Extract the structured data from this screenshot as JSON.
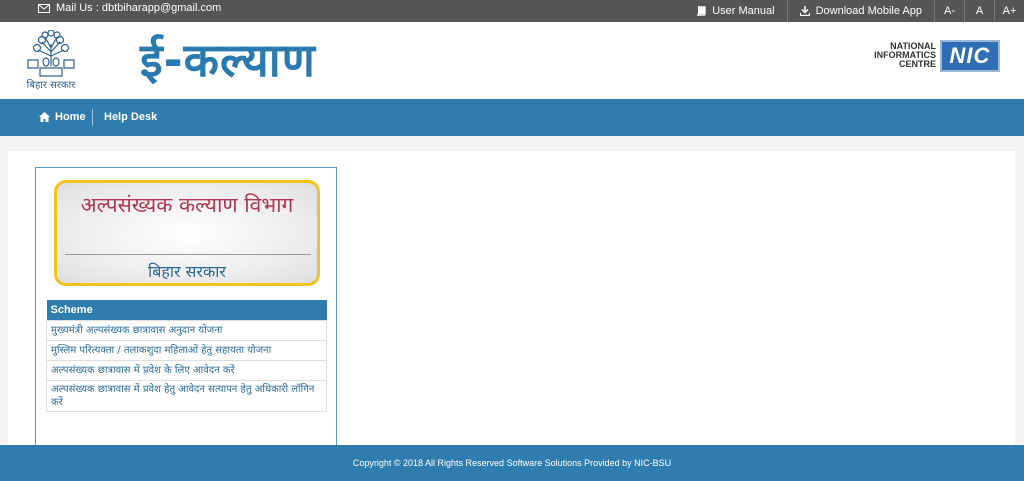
{
  "topbar": {
    "mail_label": "Mail Us : dbtbiharapp@gmail.com",
    "user_manual": "User Manual",
    "download_app": "Download Mobile App",
    "font_decrease": "A-",
    "font_normal": "A",
    "font_increase": "A+"
  },
  "header": {
    "emblem_caption": "बिहार सरकार",
    "site_title": "ई-कल्याण",
    "nic_line1": "NATIONAL",
    "nic_line2": "INFORMATICS",
    "nic_line3": "CENTRE",
    "nic_logo": "NIC"
  },
  "nav": {
    "home": "Home",
    "help_desk": "Help Desk"
  },
  "department": {
    "title": "अल्पसंख्यक कल्याण विभाग",
    "subtitle": "बिहार सरकार"
  },
  "schemes": {
    "header": "Scheme",
    "items": [
      "मुख्यमंत्री अल्पसंख्यक छात्रावास अनुदान योजना",
      "मुस्लिम परित्यक्ता / तलाकशुदा महिलाओं हेतु सहायता योजना",
      "अल्पसंख्यक छात्रावास में प्रवेश के लिए आवेदन करें",
      "अल्पसंख्यक छात्रावास में प्रवेश हेतु आवेदन सत्यापन हेतु अधिकारी लॉगिन करें"
    ]
  },
  "footer": {
    "copyright": "Copyright © 2018 All Rights Reserved Software Solutions Provided by NIC-BSU"
  },
  "colors": {
    "topbar": "#555555",
    "nav": "#2e7dae",
    "title": "#2a7ab0",
    "dept_title": "#b43657",
    "card_border": "#f4c21f"
  },
  "icons": {
    "mail": "envelope-icon",
    "manual": "book-icon",
    "download": "download-icon",
    "home": "home-icon"
  }
}
